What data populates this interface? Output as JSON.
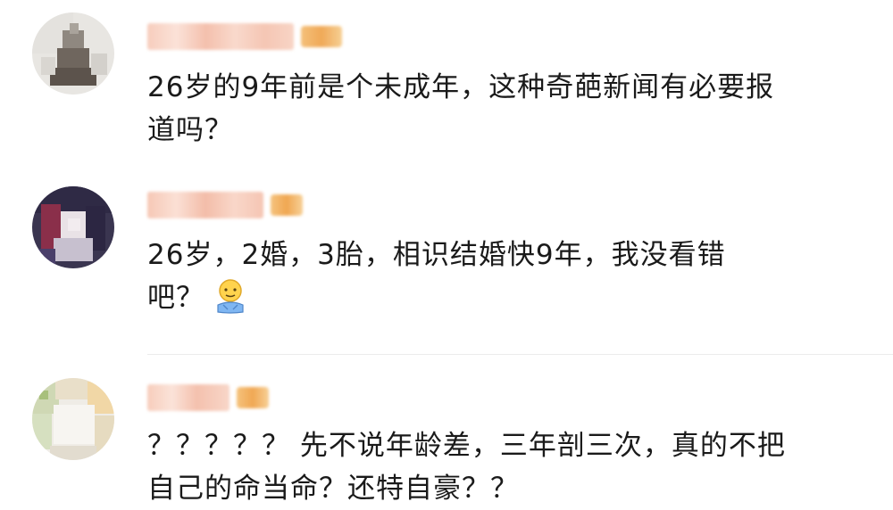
{
  "comments": [
    {
      "avatar_icon": "blurred-avatar-icon",
      "username": "",
      "text_line1": "26岁的9年前是个未成年，这种奇葩新闻有必要报",
      "text_line2": "道吗？"
    },
    {
      "avatar_icon": "blurred-avatar-icon",
      "username": "",
      "text_line1": "26岁，2婚，3胎，相识结婚快9年，我没看错",
      "text_line2": "吧？",
      "emoji": "facepalm-emoji-icon"
    },
    {
      "avatar_icon": "blurred-avatar-icon",
      "username": "",
      "text_line1": "？？？？？ 先不说年龄差，三年剖三次，真的不把",
      "text_line2": "自己的命当命？还特自豪？？"
    }
  ],
  "colors": {
    "text": "#1a1a1a",
    "divider": "#ececec",
    "blur_name": "#f6c9b8",
    "vip_badge": "#f2b36b"
  }
}
